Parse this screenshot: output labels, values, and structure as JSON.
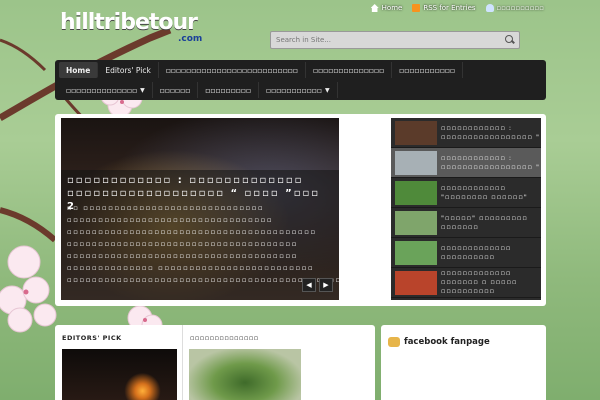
{
  "brand": {
    "logo_text": "hilltribetour",
    "logo_suffix": ".com"
  },
  "toplinks": [
    {
      "label": "Home",
      "icon": "home-icon"
    },
    {
      "label": "RSS for Entries",
      "icon": "rss-icon"
    },
    {
      "label": "▫▫▫▫▫▫▫▫▫▫",
      "icon": "user-icon"
    }
  ],
  "search": {
    "placeholder": "Search in Site..."
  },
  "nav": {
    "row1": [
      {
        "label": "Home",
        "active": true
      },
      {
        "label": "Editors' Pick"
      },
      {
        "label": "▫▫▫▫▫▫▫▫▫▫▫▫▫▫▫▫▫▫▫▫▫▫▫▫▫▫"
      },
      {
        "label": "▫▫▫▫▫▫▫▫▫▫▫▫▫▫"
      },
      {
        "label": "▫▫▫▫▫▫▫▫▫▫▫"
      }
    ],
    "row2": [
      {
        "label": "▫▫▫▫▫▫▫▫▫▫▫▫▫▫",
        "dropdown": true
      },
      {
        "label": "▫▫▫▫▫▫"
      },
      {
        "label": "▫▫▫▫▫▫▫▫▫"
      },
      {
        "label": "▫▫▫▫▫▫▫▫▫▫▫",
        "dropdown": true
      }
    ]
  },
  "featured": {
    "title": "▫▫▫▫▫▫▫▫▫▫▫▫ : ▫▫▫▫▫▫▫▫▫▫▫▫▫ ▫▫▫▫▫▫▫▫▫▫▫▫▫▫▫▫▫▫ “ ▫▫▫▫ ”▫▫▫ 2",
    "excerpt": "▫▫  ▫▫▫▫▫▫▫▫▫▫▫▫▫▫▫▫▫▫▫▫▫▫▫▫▫▫▫▫▫ ▫▫▫▫▫▫▫▫▫▫▫▫▫▫▫▫▫▫▫▫▫▫▫▫▫▫▫▫▫▫▫▫▫ ▫▫▫▫▫▫▫▫▫▫▫▫▫▫▫▫▫▫▫▫▫▫▫▫▫▫▫▫▫▫▫▫▫▫▫▫▫▫▫▫ ▫▫▫▫▫▫▫▫▫▫▫▫▫▫▫▫▫▫▫▫▫▫▫▫▫▫▫▫▫▫▫▫▫▫▫▫▫ ▫▫▫▫▫▫▫▫▫▫▫▫▫▫▫▫▫▫▫▫▫▫▫▫▫▫▫▫▫▫▫▫▫▫▫▫▫ ▫▫▫▫▫▫▫▫▫▫▫▫▫▫ ▫▫▫▫▫▫▫▫▫▫▫▫▫▫▫▫▫▫▫▫▫▫▫▫▫ ▫▫▫▫▫▫▫▫▫▫▫▫▫▫▫▫▫▫▫▫▫▫▫▫▫▫▫▫▫▫▫▫▫▫▫▫▫▫▫▫▫▫▫▫▫▫▫▫▫...",
    "prev": "◀",
    "next": "▶"
  },
  "thumbs": [
    {
      "text": "▫▫▫▫▫▫▫▫▫▫▫▫ : ▫▫▫▫▫▫▫▫▫▫▫▫▫▫▫▫▫ \"",
      "color": "#5b3b2a",
      "active": false
    },
    {
      "text": "▫▫▫▫▫▫▫▫▫▫▫▫ : ▫▫▫▫▫▫▫▫▫▫▫▫▫▫▫▫▫ \"",
      "color": "#a7b0b5",
      "active": true
    },
    {
      "text": "▫▫▫▫▫▫▫▫▫▫▫▫ \"▫▫▫▫▫▫▫▫ ▫▫▫▫▫▫\"",
      "color": "#4f8a3a",
      "active": false
    },
    {
      "text": "\"▫▫▫▫▫\" ▫▫▫▫▫▫▫▫▫ ▫▫▫▫▫▫▫",
      "color": "#7fa56b",
      "active": false
    },
    {
      "text": "▫▫▫▫▫▫▫▫▫▫▫▫▫ ▫▫▫▫▫▫▫▫▫▫",
      "color": "#6aa35a",
      "active": false
    },
    {
      "text": "▫▫▫▫▫▫▫▫▫▫▫▫▫ ▫▫▫▫▫▫▫ ▫ ▫▫▫▫▫ ▫▫▫▫▫▫▫▫▫▫",
      "color": "#b9442b",
      "active": false
    }
  ],
  "editors": {
    "heading1": "EDITORS' PICK",
    "heading2": "▫▫▫▫▫▫▫▫▫▫▫▫▫▫"
  },
  "facebook": {
    "title": "facebook fanpage"
  }
}
